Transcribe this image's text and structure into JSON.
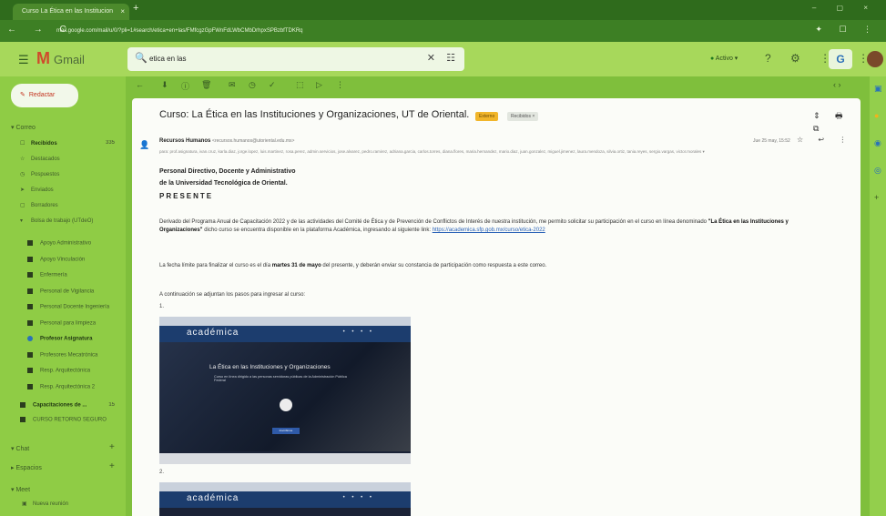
{
  "browser": {
    "tab_title": "Curso La Ética en las Institucion",
    "tab_close": "×",
    "new_tab": "+",
    "url": "mail.google.com/mail/u/0/?pli=1#search/etica+en+las/FMfcgzGpFWnFdLWbCMbDrhpxSPBzbfTDKRq",
    "nav_icons": "← → C",
    "ext_icons": "✦ ☐ ⋮",
    "window_controls": "– ▢ ×"
  },
  "gmail": {
    "menu": "☰",
    "logo_m": "M",
    "logo_word": "Gmail",
    "search_icon": "🔍",
    "search_value": "etica en las",
    "search_clear": "✕",
    "search_options": "☷",
    "status_dot": "●",
    "status": "Activo ▾",
    "header_icons": "? ⚙ ⋮⋮⋮",
    "gbadge": "G"
  },
  "sidebar": {
    "compose_icon": "✎",
    "compose": "Redactar",
    "section_correo": "▾ Correo",
    "items": [
      {
        "icon": "☐",
        "label": "Recibidos",
        "count": "335",
        "bold": true
      },
      {
        "icon": "☆",
        "label": "Destacados",
        "count": "",
        "bold": false
      },
      {
        "icon": "◷",
        "label": "Pospuestos",
        "count": "",
        "bold": false
      },
      {
        "icon": "➤",
        "label": "Enviados",
        "count": "",
        "bold": false
      },
      {
        "icon": "▢",
        "label": "Borradores",
        "count": "",
        "bold": false
      },
      {
        "icon": "▾",
        "label": "Bolsa de trabajo (UTdeO)",
        "count": "",
        "bold": false
      }
    ],
    "subitems": [
      {
        "label": "Apoyo Administrativo",
        "bold": false,
        "blue": false
      },
      {
        "label": "Apoyo Vinculación",
        "bold": false,
        "blue": false
      },
      {
        "label": "Enfermería",
        "bold": false,
        "blue": false
      },
      {
        "label": "Personal de Vigilancia",
        "bold": false,
        "blue": false
      },
      {
        "label": "Personal Docente Ingeniería",
        "bold": false,
        "blue": false
      },
      {
        "label": "Personal para limpieza",
        "bold": false,
        "blue": false
      },
      {
        "label": "Profesor Asignatura",
        "bold": true,
        "blue": true
      },
      {
        "label": "Profesores Mecatrónica",
        "bold": false,
        "blue": false
      },
      {
        "label": "Resp. Arquitectónica",
        "bold": false,
        "blue": false
      },
      {
        "label": "Resp. Arquitectónica 2",
        "bold": false,
        "blue": false
      }
    ],
    "capacitaciones": {
      "label": "Capacitaciones de ...",
      "count": "15"
    },
    "curso": "CURSO RETORNO SEGURO",
    "section_chat": "▾ Chat",
    "section_espacios": "▸ Espacios",
    "section_meet": "▾ Meet",
    "plus": "+",
    "meet_icon": "▣",
    "meet_item": "Nueva reunión"
  },
  "toolbar": {
    "back": "←",
    "icons": [
      "⬇",
      "ⓘ",
      "🗑",
      "✉",
      "◷",
      "✓",
      "⬚",
      "▷",
      "⋮"
    ],
    "pager": "‹ ›"
  },
  "email": {
    "subject": "Curso: La Ética en las Instituciones y Organizaciones, UT de Oriental.",
    "label1": "Externo",
    "label2": "Recibidos ×",
    "subject_icons": "⇕ 🖶 ⧉",
    "avatar": "👤",
    "sender_name": "Recursos Humanos",
    "sender_addr": "<recursos.humanos@utoriental.edu.mx>",
    "recipients": "para: prof.asignatura, ivan.cruz, karla.diaz, jorge.lopez, luis.martinez, rosa.perez, admin.servicios, jose.alvarez, pedro.ramirez, adriana.garcia, carlos.torres, diana.flores, maria.hernandez, mario.diaz, juan.gonzalez, miguel.jimenez, laura.mendoza, silvia.ortiz, tania.reyes, sergio.vargas, victor.morales ▾",
    "date": "Jue 25 may, 15:52",
    "mail_icons": "☆ ↩ ⋮",
    "greeting_line1": "Personal Directivo, Docente y Administrativo",
    "greeting_line2": "de la Universidad Tecnológica de Oriental.",
    "presente": "PRESENTE",
    "para1_a": "Derivado del Programa Anual de Capacitación 2022 y de las actividades del Comité de Ética y de Prevención de Conflictos de Interés de nuestra institución, me permito solicitar su participación en el curso en línea denominado ",
    "para1_bold": "\"La Ética en las Instituciones y Organizaciones\"",
    "para1_b": " dicho curso se encuentra disponible en la plataforma Académica, ingresando al siguiente link: ",
    "para1_link": "https://academica.sfp.gob.mx/curso/etica-2022",
    "para2_a": "La fecha límite para finalizar el curso es el día ",
    "para2_bold": "martes 31 de mayo",
    "para2_b": " del presente, y deberán enviar su constancia de participación como respuesta a este correo.",
    "para3": "A continuación se adjuntan los pasos para ingresar al curso:",
    "step1": "1.",
    "step2": "2.",
    "shot1": {
      "brand": "académica",
      "nav": "• • • •",
      "title": "La Ética en las Instituciones y Organizaciones",
      "subtitle": "Curso en línea dirigido a las personas servidoras públicas de la Administración Pública Federal",
      "button": "Inscribirme"
    },
    "shot2": {
      "brand": "académica",
      "nav": "• • • •"
    }
  },
  "rightbar": {
    "icons": [
      {
        "glyph": "▣",
        "color": "#2a72b8"
      },
      {
        "glyph": "●",
        "color": "#f2b21c"
      },
      {
        "glyph": "◉",
        "color": "#2a72b8"
      },
      {
        "glyph": "◎",
        "color": "#1f67c4"
      },
      {
        "glyph": "+",
        "color": "#3b5a22"
      }
    ]
  }
}
